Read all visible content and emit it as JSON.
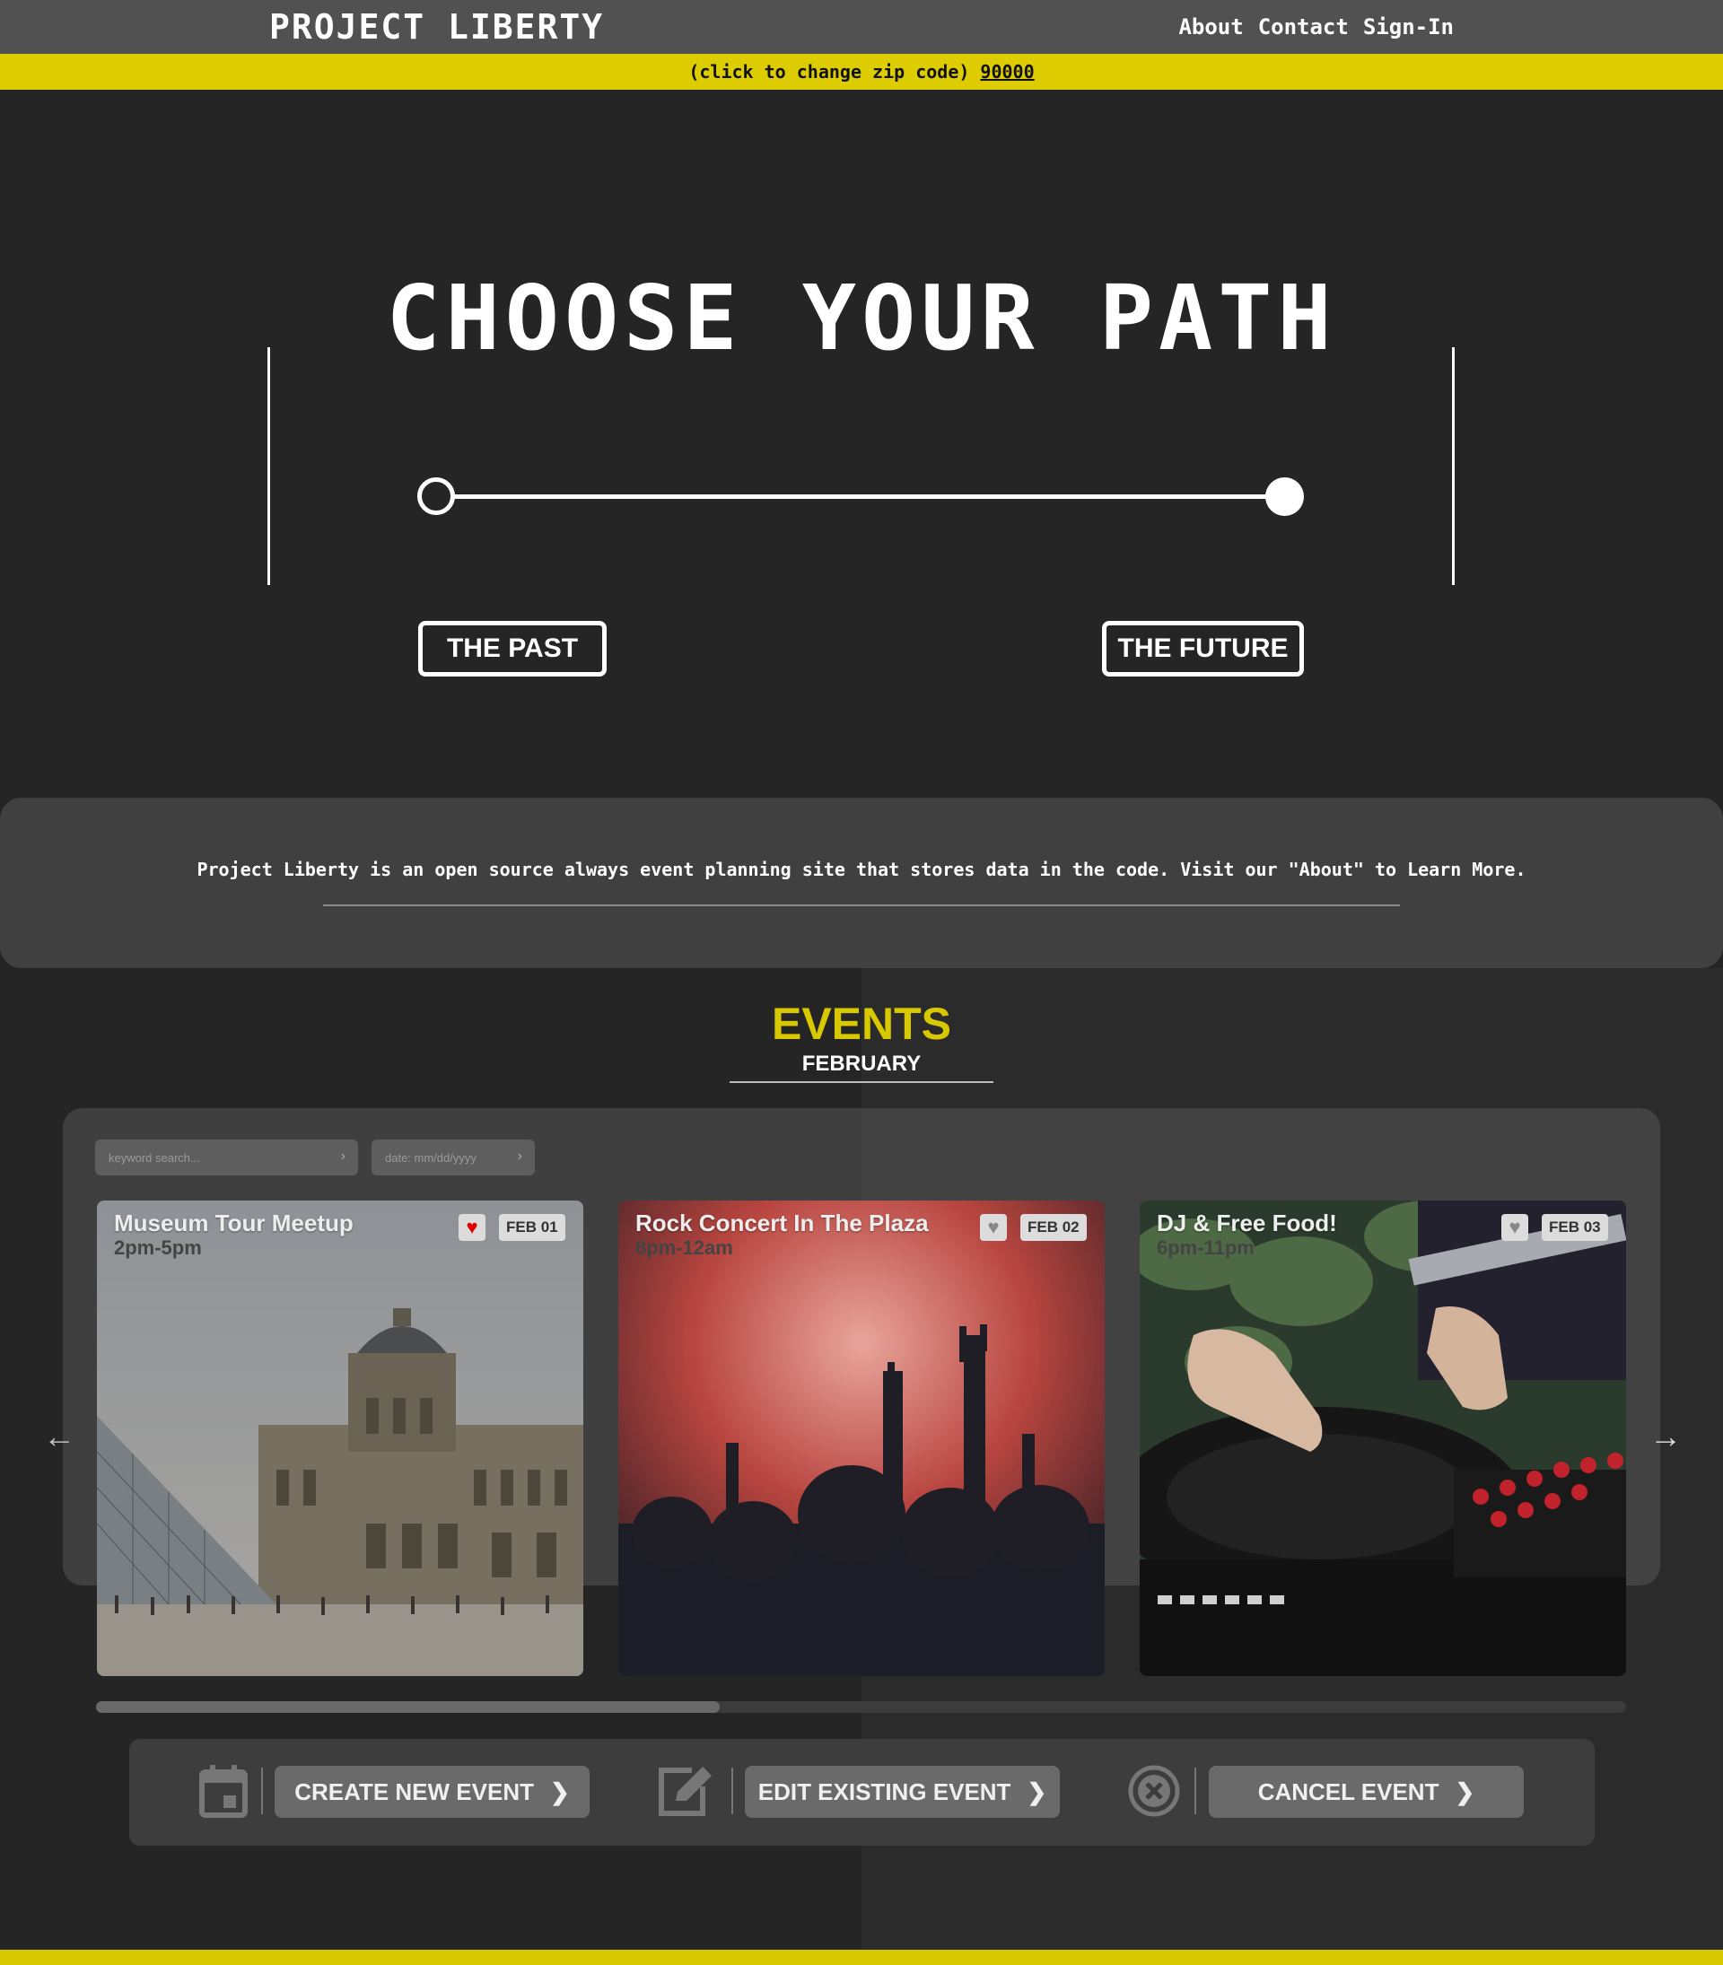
{
  "header": {
    "brand": "PROJECT LIBERTY",
    "nav": [
      "About",
      "Contact",
      "Sign-In"
    ]
  },
  "zip_bar": {
    "prompt": "(click to change zip code)",
    "zip": "90000"
  },
  "hero": {
    "title": "CHOOSE YOUR PATH",
    "past_label": "THE PAST",
    "future_label": "THE FUTURE",
    "slider_value": 1.0
  },
  "info": {
    "text": "Project Liberty is an open source always event planning site that stores data in the code. Visit our \"About\" to Learn More."
  },
  "events": {
    "title": "EVENTS",
    "month": "FEBRUARY",
    "search_placeholder": "keyword search...",
    "date_placeholder": "date: mm/dd/yyyy",
    "cards": [
      {
        "title": "Museum Tour Meetup",
        "time": "2pm-5pm",
        "date": "FEB 01",
        "favorited": true
      },
      {
        "title": "Rock Concert In The Plaza",
        "time": "8pm-12am",
        "date": "FEB 02",
        "favorited": false
      },
      {
        "title": "DJ & Free Food!",
        "time": "6pm-11pm",
        "date": "FEB 03",
        "favorited": false
      }
    ],
    "scroll_progress": 0.41
  },
  "actions": {
    "create": "CREATE NEW EVENT",
    "edit": "EDIT EXISTING EVENT",
    "cancel": "CANCEL EVENT"
  },
  "colors": {
    "accent_yellow": "#ddcd00",
    "background": "#252525",
    "nav_bg": "#525151"
  }
}
